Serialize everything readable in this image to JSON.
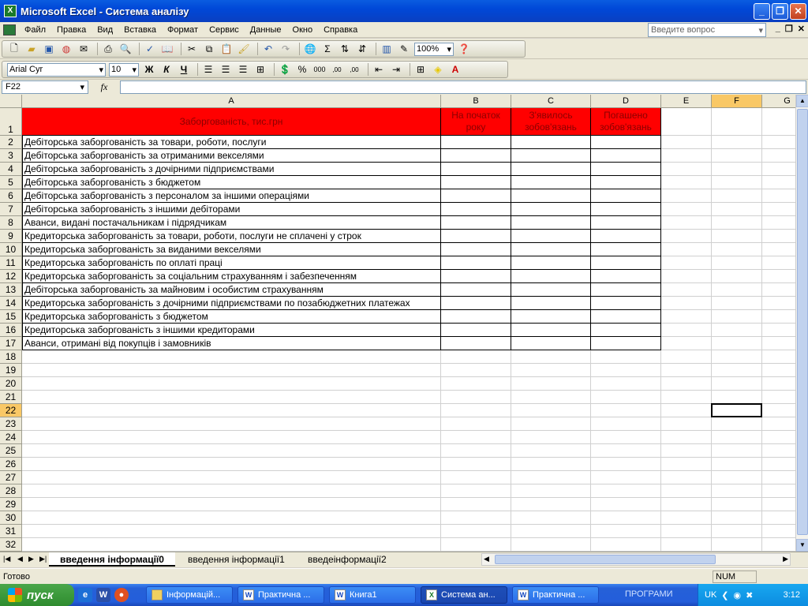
{
  "window": {
    "title": "Microsoft Excel - Система аналізу",
    "minimize_glyph": "_",
    "maximize_glyph": "❐",
    "close_glyph": "✕"
  },
  "menu": {
    "items": [
      "Файл",
      "Правка",
      "Вид",
      "Вставка",
      "Формат",
      "Сервис",
      "Данные",
      "Окно",
      "Справка"
    ],
    "ask_placeholder": "Введите вопрос",
    "mdi_min": "_",
    "mdi_restore": "❐",
    "mdi_close": "✕"
  },
  "toolbar": {
    "zoom": "100%",
    "font_name": "Arial Cyr",
    "font_size": "10",
    "bold": "Ж",
    "italic": "К",
    "underline": "Ч",
    "sum": "Σ",
    "percent": "%",
    "thousands": "000",
    "inc_dec": ",00",
    "dec_dec": ",00"
  },
  "formula_bar": {
    "name_box": "F22",
    "fx": "fx",
    "value": ""
  },
  "sheet": {
    "columns": [
      "A",
      "B",
      "C",
      "D",
      "E",
      "F",
      "G"
    ],
    "selected_column": "F",
    "selected_row": "22",
    "header": {
      "a": "Заборгованість, тис.грн",
      "b1": "На початок",
      "b2": "року",
      "c1": "З'явилось",
      "c2": "зобов'язань",
      "d1": "Погашено",
      "d2": "зобов'язань"
    },
    "rows": [
      "Дебіторська заборгованість за товари, роботи, послуги",
      "Дебіторська заборгованість за отриманими векселями",
      "Дебіторська заборгованість з дочірними підприємствами",
      "Дебіторська заборгованість з бюджетом",
      "Дебіторська заборгованість з персоналом за іншими операціями",
      "Дебіторська заборгованість з іншими дебіторами",
      "Аванси, видані постачальникам і підрядчикам",
      "Кредиторська заборгованість за товари, роботи, послуги не сплачені у строк",
      "Кредиторська заборгованість за виданими векселями",
      "Кредиторська заборгованість по оплаті праці",
      "Кредиторська заборгованість за соціальним страхуванням і забезпеченням",
      "Дебіторська заборгованість за майновим і особистим страхуванням",
      "Кредиторська заборгованість з дочірними підприємствами по позабюджетних платежах",
      "Кредиторська заборгованість з бюджетом",
      "Кредиторська заборгованість з іншими кредиторами",
      "Аванси, отримані від покупців і замовників"
    ],
    "row_numbers": [
      "1",
      "2",
      "3",
      "4",
      "5",
      "6",
      "7",
      "8",
      "9",
      "10",
      "11",
      "12",
      "13",
      "14",
      "15",
      "16",
      "17",
      "18",
      "19",
      "20",
      "21",
      "22",
      "23",
      "24",
      "25",
      "26",
      "27",
      "28",
      "29",
      "30",
      "31",
      "32"
    ]
  },
  "tabs": {
    "items": [
      "введення інформації0",
      "введення інформації1",
      "введеінформації2"
    ],
    "active": 0
  },
  "status": {
    "left": "Готово",
    "num": "NUM"
  },
  "taskbar": {
    "start": "пуск",
    "buttons": [
      {
        "label": "Інформацій...",
        "icon": "folder-icon"
      },
      {
        "label": "Практична ...",
        "icon": "word-icon"
      },
      {
        "label": "Книга1",
        "icon": "word-icon"
      },
      {
        "label": "Система ан...",
        "icon": "excel-icon"
      },
      {
        "label": "Практична ...",
        "icon": "word-icon"
      }
    ],
    "programs": "ПРОГРАМИ",
    "lang": "UK",
    "clock": "3:12"
  },
  "colors": {
    "header_red": "#ff0000",
    "selected_header": "#f9c866",
    "title_blue": "#0048d8"
  }
}
